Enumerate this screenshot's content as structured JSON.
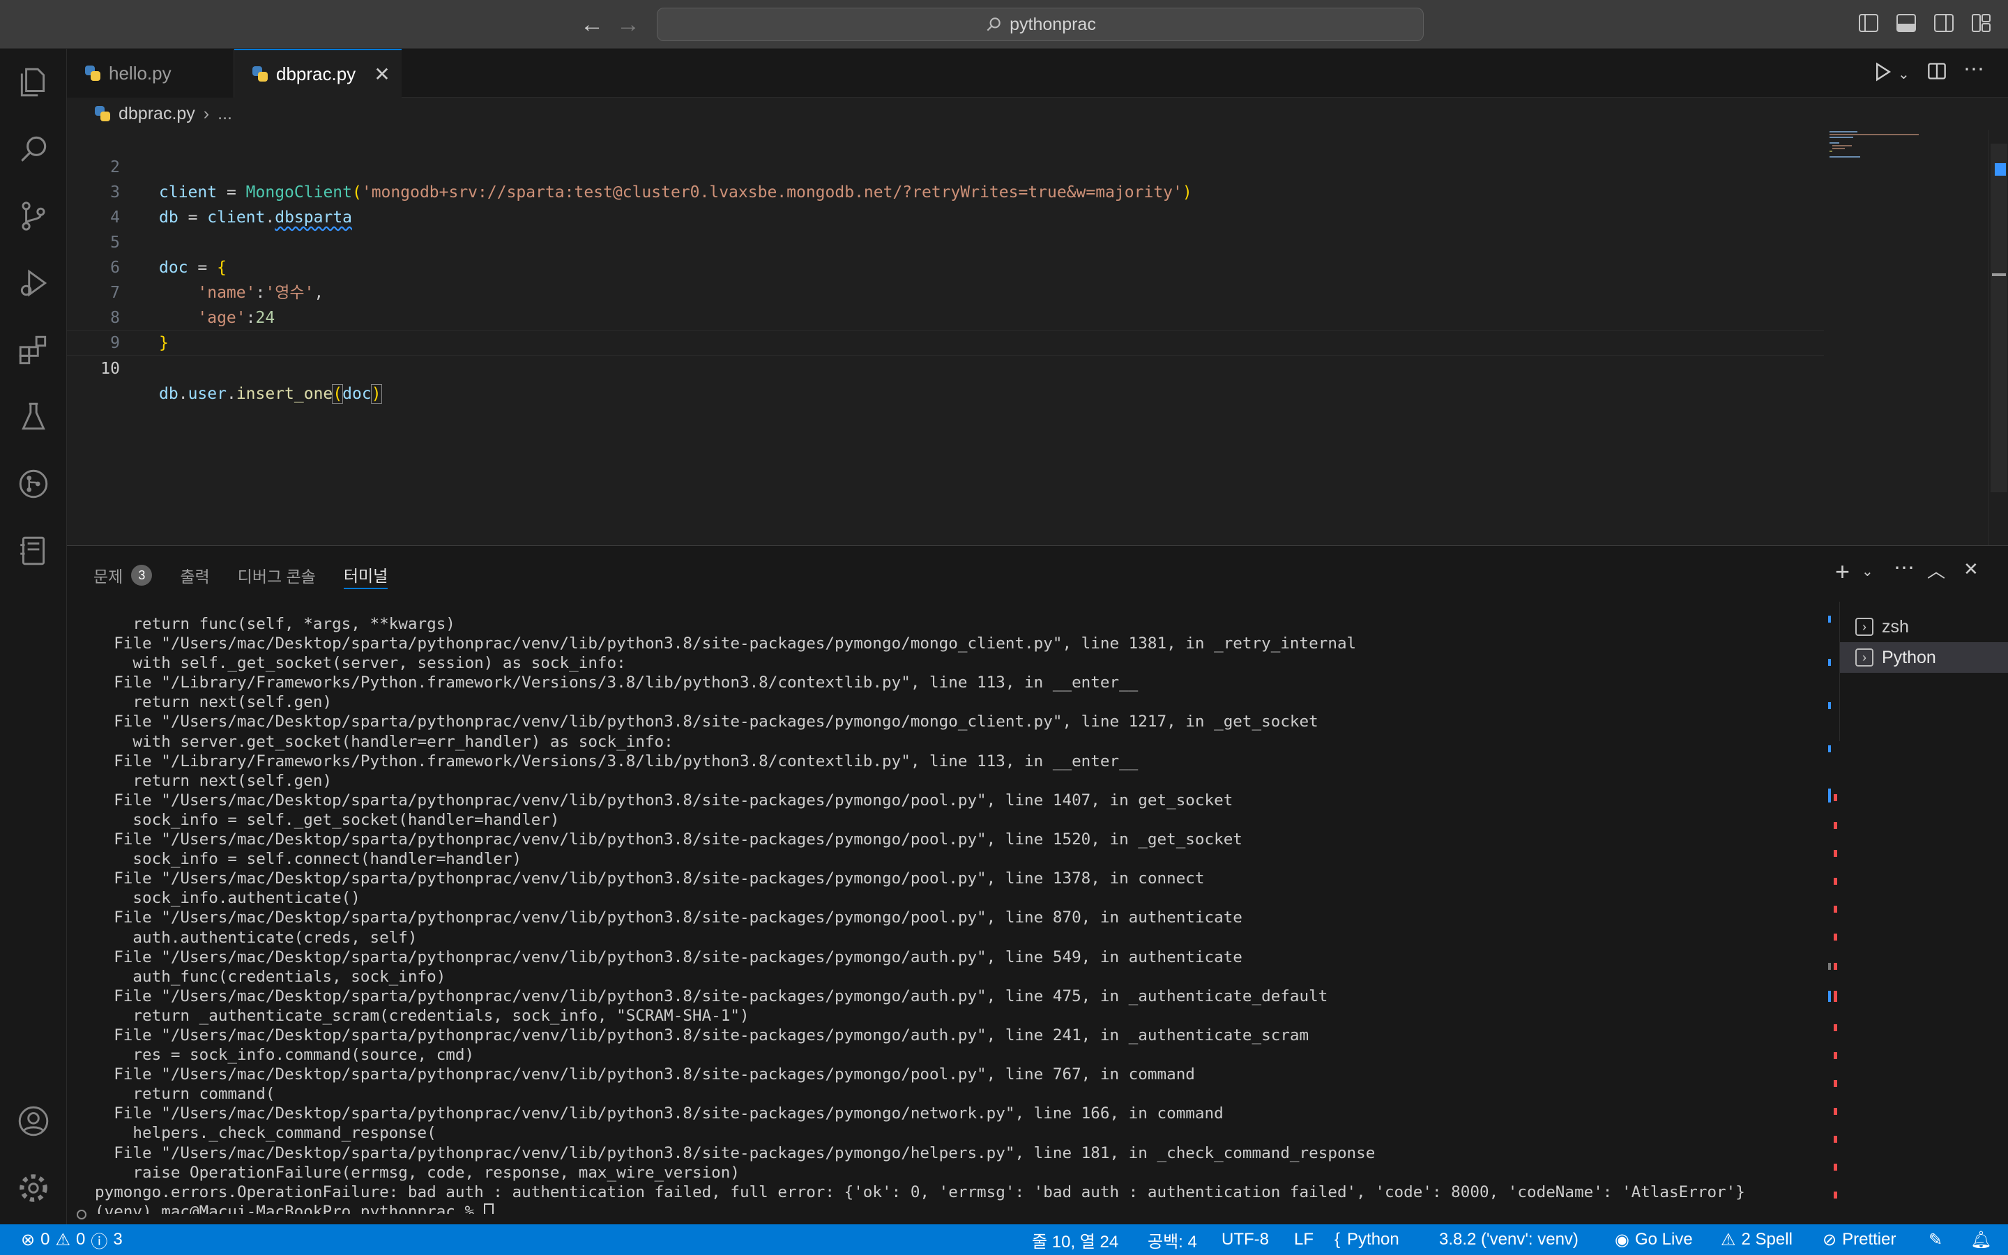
{
  "titlebar": {
    "search_text": "pythonprac"
  },
  "tabs": [
    {
      "label": "hello.py"
    },
    {
      "label": "dbprac.py"
    }
  ],
  "tab_close_glyph": "✕",
  "breadcrumb": {
    "file": "dbprac.py",
    "separator": "›",
    "rest": "..."
  },
  "editor": {
    "current_line": 10,
    "line_numbers": [
      "2",
      "3",
      "4",
      "5",
      "6",
      "7",
      "8",
      "9",
      "10"
    ]
  },
  "panel": {
    "tabs": [
      {
        "label": "문제",
        "badge": "3"
      },
      {
        "label": "출력"
      },
      {
        "label": "디버그 콘솔"
      },
      {
        "label": "터미널"
      }
    ],
    "terminals": [
      {
        "label": "zsh"
      },
      {
        "label": "Python"
      }
    ],
    "output_lines": [
      "    return func(self, *args, **kwargs)",
      "  File \"/Users/mac/Desktop/sparta/pythonprac/venv/lib/python3.8/site-packages/pymongo/mongo_client.py\", line 1381, in _retry_internal",
      "    with self._get_socket(server, session) as sock_info:",
      "  File \"/Library/Frameworks/Python.framework/Versions/3.8/lib/python3.8/contextlib.py\", line 113, in __enter__",
      "    return next(self.gen)",
      "  File \"/Users/mac/Desktop/sparta/pythonprac/venv/lib/python3.8/site-packages/pymongo/mongo_client.py\", line 1217, in _get_socket",
      "    with server.get_socket(handler=err_handler) as sock_info:",
      "  File \"/Library/Frameworks/Python.framework/Versions/3.8/lib/python3.8/contextlib.py\", line 113, in __enter__",
      "    return next(self.gen)",
      "  File \"/Users/mac/Desktop/sparta/pythonprac/venv/lib/python3.8/site-packages/pymongo/pool.py\", line 1407, in get_socket",
      "    sock_info = self._get_socket(handler=handler)",
      "  File \"/Users/mac/Desktop/sparta/pythonprac/venv/lib/python3.8/site-packages/pymongo/pool.py\", line 1520, in _get_socket",
      "    sock_info = self.connect(handler=handler)",
      "  File \"/Users/mac/Desktop/sparta/pythonprac/venv/lib/python3.8/site-packages/pymongo/pool.py\", line 1378, in connect",
      "    sock_info.authenticate()",
      "  File \"/Users/mac/Desktop/sparta/pythonprac/venv/lib/python3.8/site-packages/pymongo/pool.py\", line 870, in authenticate",
      "    auth.authenticate(creds, self)",
      "  File \"/Users/mac/Desktop/sparta/pythonprac/venv/lib/python3.8/site-packages/pymongo/auth.py\", line 549, in authenticate",
      "    auth_func(credentials, sock_info)",
      "  File \"/Users/mac/Desktop/sparta/pythonprac/venv/lib/python3.8/site-packages/pymongo/auth.py\", line 475, in _authenticate_default",
      "    return _authenticate_scram(credentials, sock_info, \"SCRAM-SHA-1\")",
      "  File \"/Users/mac/Desktop/sparta/pythonprac/venv/lib/python3.8/site-packages/pymongo/auth.py\", line 241, in _authenticate_scram",
      "    res = sock_info.command(source, cmd)",
      "  File \"/Users/mac/Desktop/sparta/pythonprac/venv/lib/python3.8/site-packages/pymongo/pool.py\", line 767, in command",
      "    return command(",
      "  File \"/Users/mac/Desktop/sparta/pythonprac/venv/lib/python3.8/site-packages/pymongo/network.py\", line 166, in command",
      "    helpers._check_command_response(",
      "  File \"/Users/mac/Desktop/sparta/pythonprac/venv/lib/python3.8/site-packages/pymongo/helpers.py\", line 181, in _check_command_response",
      "    raise OperationFailure(errmsg, code, response, max_wire_version)",
      "pymongo.errors.OperationFailure: bad auth : authentication failed, full error: {'ok': 0, 'errmsg': 'bad auth : authentication failed', 'code': 8000, 'codeName': 'AtlasError'}"
    ],
    "prompt": "(venv) mac@Macui-MacBookPro pythonprac % "
  },
  "statusbar": {
    "errors": "0",
    "warnings": "0",
    "infos": "3",
    "position": "줄 10, 열 24",
    "spaces": "공백: 4",
    "encoding": "UTF-8",
    "eol": "LF",
    "language": "Python",
    "interpreter": "3.8.2 ('venv': venv)",
    "golive": "Go Live",
    "spell": "2 Spell",
    "prettier": "Prettier"
  },
  "colors": {
    "accent": "#0078d4",
    "editor_bg": "#1f1f1f",
    "panel_bg": "#181818",
    "string": "#ce9178",
    "class": "#4ec9b0",
    "variable": "#9cdcfe"
  },
  "icons": [
    "back-arrow-icon",
    "forward-arrow-icon",
    "search-icon",
    "files-icon",
    "source-control-icon",
    "run-debug-icon",
    "extensions-icon",
    "testing-icon",
    "git-graph-icon",
    "notebook-icon",
    "account-icon",
    "settings-gear-icon",
    "run-icon",
    "split-editor-icon",
    "more-icon",
    "add-terminal-icon",
    "maximize-icon",
    "close-icon"
  ]
}
